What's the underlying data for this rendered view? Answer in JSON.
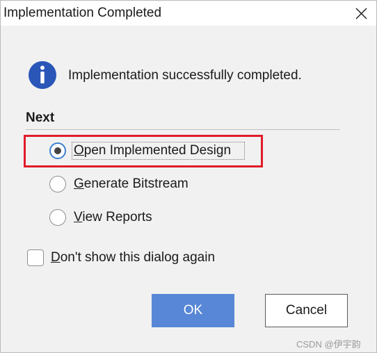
{
  "window": {
    "title": "Implementation Completed",
    "close_icon": "close-icon"
  },
  "message": {
    "icon": "info-icon",
    "text": "Implementation successfully completed."
  },
  "next": {
    "label": "Next",
    "options": [
      {
        "mnemonic": "O",
        "rest": "pen Implemented Design",
        "selected": true
      },
      {
        "mnemonic": "G",
        "rest": "enerate Bitstream",
        "selected": false
      },
      {
        "mnemonic": "V",
        "rest": "iew Reports",
        "selected": false
      }
    ]
  },
  "dont_show": {
    "mnemonic": "D",
    "rest": "on't show this dialog again",
    "checked": false
  },
  "buttons": {
    "ok": "OK",
    "cancel": "Cancel"
  },
  "colors": {
    "primary_button": "#5787d6",
    "highlight_annotation": "#e01b2a",
    "info_icon": "#2a56b8"
  },
  "watermark": "CSDN @伊宇韵"
}
